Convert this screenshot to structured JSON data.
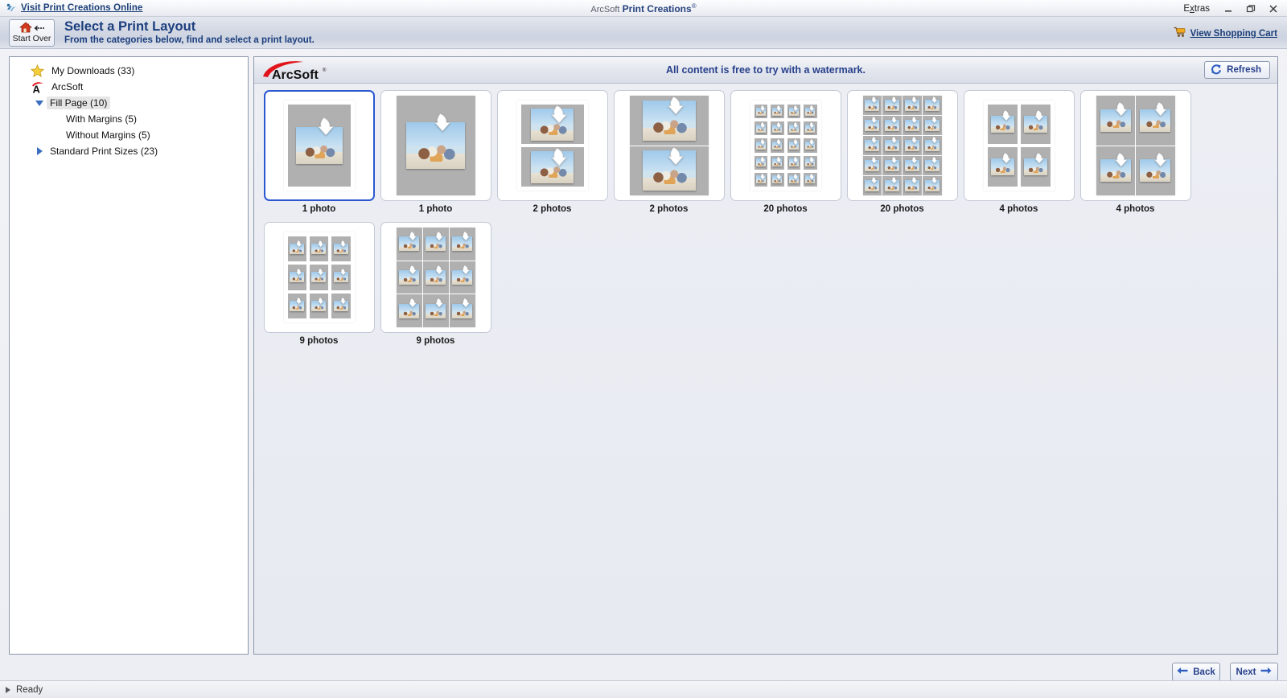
{
  "titlebar": {
    "online_link": "Visit Print Creations Online",
    "brand_prefix": "ArcSoft",
    "brand_name": "Print Creations",
    "brand_mark": "®",
    "extras_label": "Extras",
    "minimize": "minimize-icon",
    "restore": "restore-icon",
    "close": "close-icon",
    "app_icon": "print-creations-icon"
  },
  "header": {
    "start_over_label": "Start Over",
    "title": "Select a Print Layout",
    "subtitle": "From the categories below, find and select a print layout.",
    "cart_label": "View Shopping Cart",
    "cart_icon": "shopping-cart-icon",
    "home_icon": "home-icon",
    "back-arrow_icon": "left-arrow-icon"
  },
  "sidebar": {
    "items": [
      {
        "label": "My Downloads (33)",
        "indent": 0,
        "icon": "star-icon",
        "twisty": "none",
        "selected": false
      },
      {
        "label": "ArcSoft",
        "indent": 0,
        "icon": "arcsoft-a-icon",
        "twisty": "none",
        "selected": false
      },
      {
        "label": "Fill Page (10)",
        "indent": 1,
        "icon": "none",
        "twisty": "open",
        "selected": true
      },
      {
        "label": "With Margins (5)",
        "indent": 2,
        "icon": "none",
        "twisty": "none",
        "selected": false
      },
      {
        "label": "Without Margins (5)",
        "indent": 2,
        "icon": "none",
        "twisty": "none",
        "selected": false
      },
      {
        "label": "Standard Print Sizes (23)",
        "indent": 1,
        "icon": "none",
        "twisty": "closed",
        "selected": false
      }
    ]
  },
  "content": {
    "logo_text": "ArcSoft",
    "logo_mark": "®",
    "notice": "All content is free to try with a watermark.",
    "refresh_label": "Refresh",
    "refresh_icon": "refresh-icon",
    "layouts": [
      {
        "caption": "1 photo",
        "cols": 1,
        "rows": 1,
        "margins": true,
        "selected": true,
        "orientation": "portrait"
      },
      {
        "caption": "1 photo",
        "cols": 1,
        "rows": 1,
        "margins": false,
        "selected": false,
        "orientation": "portrait"
      },
      {
        "caption": "2 photos",
        "cols": 1,
        "rows": 2,
        "margins": true,
        "selected": false,
        "orientation": "landscape"
      },
      {
        "caption": "2 photos",
        "cols": 1,
        "rows": 2,
        "margins": false,
        "selected": false,
        "orientation": "landscape"
      },
      {
        "caption": "20 photos",
        "cols": 4,
        "rows": 5,
        "margins": true,
        "selected": false,
        "orientation": "portrait"
      },
      {
        "caption": "20 photos",
        "cols": 4,
        "rows": 5,
        "margins": false,
        "selected": false,
        "orientation": "portrait"
      },
      {
        "caption": "4 photos",
        "cols": 2,
        "rows": 2,
        "margins": true,
        "selected": false,
        "orientation": "landscape"
      },
      {
        "caption": "4 photos",
        "cols": 2,
        "rows": 2,
        "margins": false,
        "selected": false,
        "orientation": "landscape"
      },
      {
        "caption": "9 photos",
        "cols": 3,
        "rows": 3,
        "margins": true,
        "selected": false,
        "orientation": "landscape"
      },
      {
        "caption": "9 photos",
        "cols": 3,
        "rows": 3,
        "margins": false,
        "selected": false,
        "orientation": "landscape"
      }
    ]
  },
  "footer": {
    "back_label": "Back",
    "next_label": "Next",
    "back_icon": "left-arrow-icon",
    "next_icon": "right-arrow-icon"
  },
  "statusbar": {
    "text": "Ready",
    "icon": "triangle-right-icon"
  },
  "colors": {
    "accent_blue": "#27408b",
    "link_blue": "#1b3f78",
    "selection_blue": "#2b57d0",
    "logo_red": "#e1141b",
    "page_gray": "#b0b0b0"
  }
}
